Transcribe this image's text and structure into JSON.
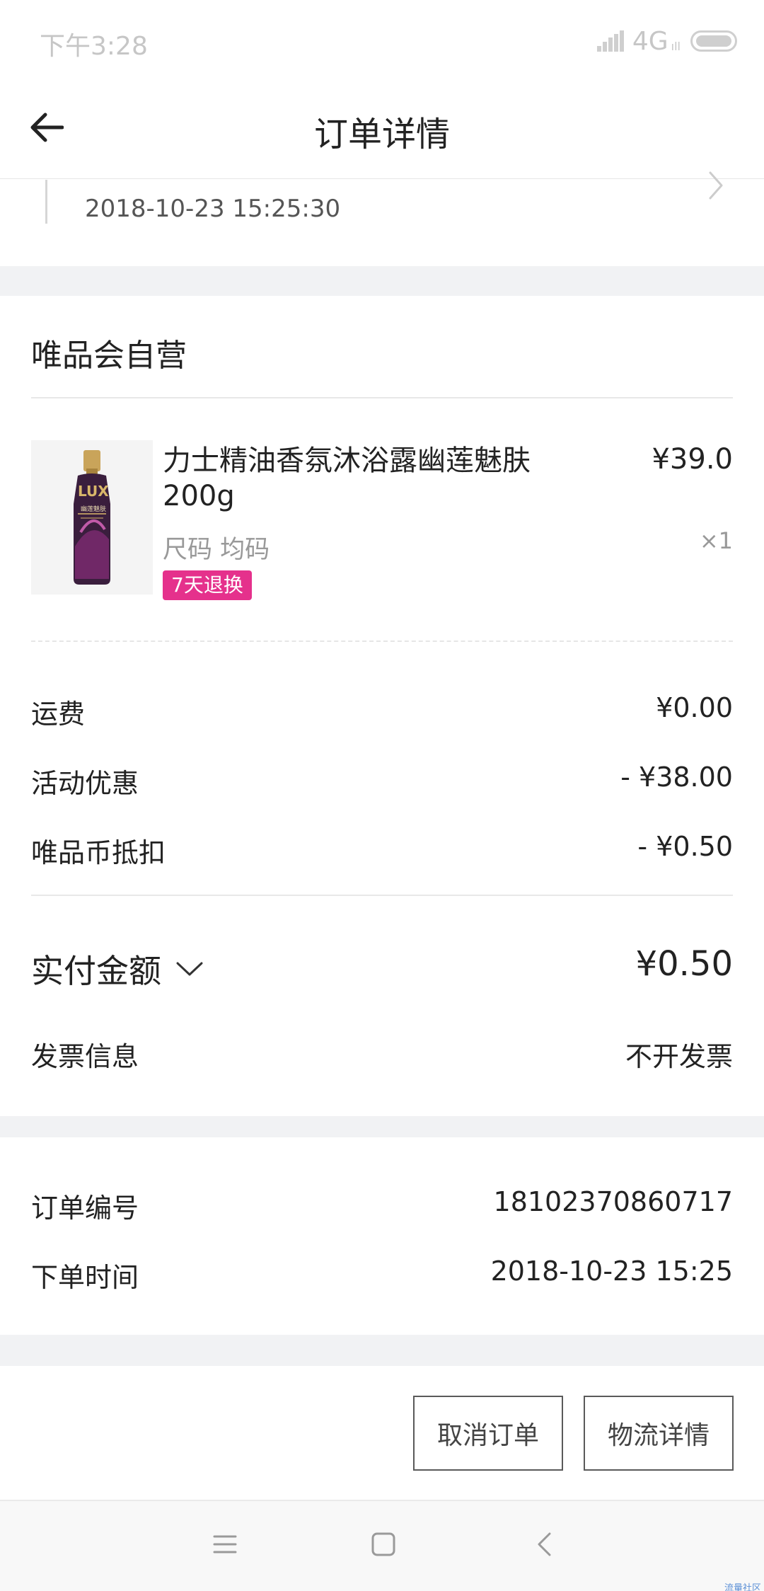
{
  "status_bar": {
    "time": "下午3:28",
    "network": "4G",
    "network_sub": "ıll"
  },
  "header": {
    "title": "订单详情"
  },
  "tracking": {
    "datetime": "2018-10-23 15:25:30"
  },
  "store": {
    "name": "唯品会自营"
  },
  "product": {
    "name": "力士精油香氛沐浴露幽莲魅肤200g",
    "price": "¥39.0",
    "size": "尺码 均码",
    "quantity": "×1",
    "badge": "7天退换",
    "image_brand": "LUX",
    "image_subtext": "幽莲魅肤"
  },
  "costs": [
    {
      "label": "运费",
      "value": "¥0.00"
    },
    {
      "label": "活动优惠",
      "value": "- ¥38.00"
    },
    {
      "label": "唯品币抵扣",
      "value": "- ¥0.50"
    }
  ],
  "paid": {
    "label": "实付金额",
    "value": "¥0.50"
  },
  "invoice": {
    "label": "发票信息",
    "value": "不开发票"
  },
  "order_info": [
    {
      "label": "订单编号",
      "value": "18102370860717"
    },
    {
      "label": "下单时间",
      "value": "2018-10-23 15:25"
    }
  ],
  "actions": {
    "cancel": "取消订单",
    "logistics": "物流详情"
  },
  "watermark": "流量社区",
  "colors": {
    "badge": "#e5318c",
    "divider": "#f1f2f4",
    "text": "#222222",
    "muted": "#999999"
  }
}
